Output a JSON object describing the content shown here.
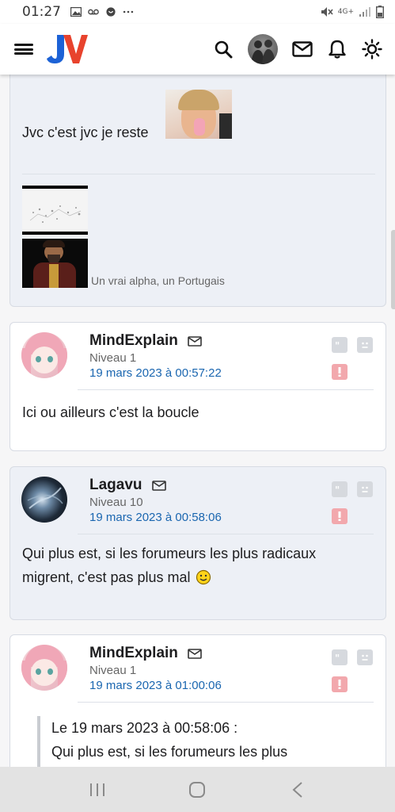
{
  "status_bar": {
    "time": "01:27",
    "network": "4G+"
  },
  "app": {
    "logo_text": "JV"
  },
  "posts": [
    {
      "text": "Jvc c'est jvc je reste",
      "image_caption": "Un vrai alpha, un Portugais"
    },
    {
      "author": "MindExplain",
      "level": "Niveau 1",
      "date": "19 mars 2023 à 00:57:22",
      "text": "Ici ou ailleurs c'est la boucle"
    },
    {
      "author": "Lagavu",
      "level": "Niveau 10",
      "date": "19 mars 2023 à 00:58:06",
      "text_line1": "Qui plus est, si les forumeurs les plus radicaux",
      "text_line2": "migrent, c'est pas plus mal"
    },
    {
      "author": "MindExplain",
      "level": "Niveau 1",
      "date": "19 mars 2023 à 01:00:06",
      "quote_header": "Le 19 mars 2023 à 00:58:06 :",
      "quote_text": "Qui plus est, si les forumeurs les plus"
    }
  ],
  "colors": {
    "accent_blue": "#1a66b0",
    "logo_blue": "#1c62d6",
    "logo_red": "#e8432d",
    "alert_red": "#f2a8ad"
  },
  "icons": [
    "menu-icon",
    "search-icon",
    "mail-icon",
    "bell-icon",
    "sun-icon",
    "quote-icon",
    "sad-face-icon",
    "alert-icon"
  ]
}
